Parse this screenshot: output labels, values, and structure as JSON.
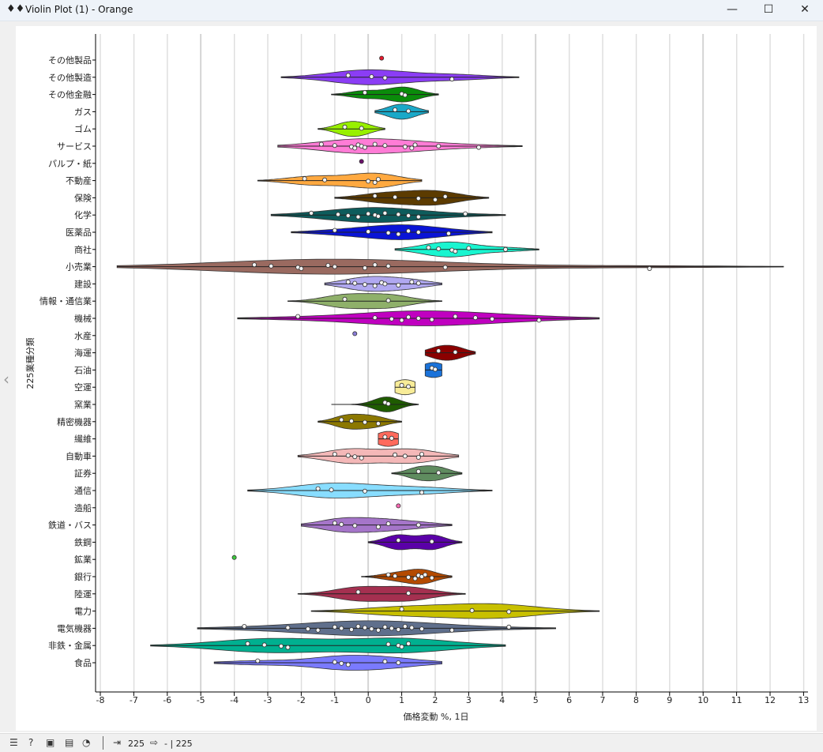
{
  "window": {
    "title": "Violin Plot (1) - Orange",
    "app_icon": "violin-plot-icon",
    "controls": {
      "minimize": "—",
      "maximize": "☐",
      "close": "✕"
    }
  },
  "statusbar": {
    "icons": [
      "menu-icon",
      "help-icon",
      "save-icon",
      "report-icon",
      "snail-icon"
    ],
    "input_label": "225",
    "output_label": "- | 225"
  },
  "colors": {
    "chart_bg": "#ffffff",
    "frame_bg": "#f0f0f0",
    "grid_minor": "#d0d0d0",
    "grid_major": "#888888"
  },
  "chart_data": {
    "type": "violin",
    "orientation": "horizontal",
    "title": "",
    "xlabel": "価格変動 %, 1日",
    "ylabel": "225業種分類",
    "xlim": [
      -8,
      13
    ],
    "x_ticks": [
      "-8",
      "-7",
      "-6",
      "-5",
      "-4",
      "-3",
      "-2",
      "-1",
      "0",
      "1",
      "2",
      "3",
      "4",
      "5",
      "6",
      "7",
      "8",
      "9",
      "10",
      "11",
      "12",
      "13"
    ],
    "grid": true,
    "categories": [
      {
        "name": "その他製品",
        "color": "#e8192c",
        "lo": 0.4,
        "hi": 0.4,
        "points": [
          0.4
        ]
      },
      {
        "name": "その他製造",
        "color": "#8b3df5",
        "lo": -2.6,
        "hi": 4.5,
        "points": [
          -0.6,
          0.1,
          0.5,
          2.5
        ]
      },
      {
        "name": "その他金融",
        "color": "#0a8c0a",
        "lo": -1.1,
        "hi": 2.1,
        "points": [
          -0.1,
          1.0,
          1.1
        ]
      },
      {
        "name": "ガス",
        "color": "#1aa8c8",
        "lo": 0.2,
        "hi": 1.8,
        "points": [
          0.8,
          1.2
        ]
      },
      {
        "name": "ゴム",
        "color": "#98f000",
        "lo": -1.5,
        "hi": 0.5,
        "points": [
          -0.7,
          -0.2
        ]
      },
      {
        "name": "サービス",
        "color": "#ff7cd6",
        "lo": -2.7,
        "hi": 4.6,
        "points": [
          -1.4,
          -1.0,
          -0.5,
          -0.4,
          -0.3,
          -0.2,
          -0.1,
          0.2,
          0.5,
          1.1,
          1.3,
          1.4,
          2.1,
          3.3
        ]
      },
      {
        "name": "パルプ・紙",
        "color": "#6c0f6c",
        "lo": -0.2,
        "hi": -0.2,
        "points": [
          -0.2
        ]
      },
      {
        "name": "不動産",
        "color": "#ffa940",
        "lo": -3.3,
        "hi": 1.6,
        "points": [
          -1.9,
          -1.3,
          0.0,
          0.2,
          0.3
        ]
      },
      {
        "name": "保険",
        "color": "#5c3b00",
        "lo": -1.0,
        "hi": 3.6,
        "points": [
          0.2,
          0.8,
          1.5,
          2.0,
          2.3
        ]
      },
      {
        "name": "化学",
        "color": "#0d5c5c",
        "lo": -2.9,
        "hi": 4.1,
        "points": [
          -1.7,
          -0.9,
          -0.6,
          -0.3,
          0.0,
          0.2,
          0.3,
          0.5,
          0.9,
          1.2,
          1.5,
          2.9
        ]
      },
      {
        "name": "医薬品",
        "color": "#0a14d6",
        "lo": -2.3,
        "hi": 3.7,
        "points": [
          -1.0,
          0.0,
          0.6,
          0.9,
          1.2,
          1.5,
          2.4
        ]
      },
      {
        "name": "商社",
        "color": "#19f5d0",
        "lo": 0.8,
        "hi": 5.1,
        "points": [
          1.8,
          2.1,
          2.5,
          2.6,
          3.0,
          4.1
        ]
      },
      {
        "name": "小売業",
        "color": "#9a6a60",
        "lo": -7.5,
        "hi": 12.4,
        "points": [
          -3.4,
          -2.9,
          -2.1,
          -2.0,
          -1.2,
          -1.0,
          -0.1,
          0.2,
          0.6,
          2.3,
          8.4
        ]
      },
      {
        "name": "建設",
        "color": "#b0a8f0",
        "lo": -1.3,
        "hi": 2.2,
        "points": [
          -0.6,
          -0.4,
          -0.1,
          0.2,
          0.4,
          0.5,
          0.9,
          1.3,
          1.5
        ]
      },
      {
        "name": "情報・通信業",
        "color": "#8fb06a",
        "lo": -2.4,
        "hi": 2.2,
        "points": [
          -0.7,
          0.6
        ]
      },
      {
        "name": "機械",
        "color": "#c000c0",
        "lo": -3.9,
        "hi": 6.9,
        "points": [
          -2.1,
          0.2,
          0.7,
          1.0,
          1.2,
          1.5,
          1.9,
          2.6,
          3.2,
          3.7,
          5.1
        ]
      },
      {
        "name": "水産",
        "color": "#8a7cd8",
        "lo": -0.4,
        "hi": -0.4,
        "points": [
          -0.4
        ]
      },
      {
        "name": "海運",
        "color": "#8b0000",
        "lo": 1.7,
        "hi": 3.2,
        "points": [
          2.1,
          2.6
        ]
      },
      {
        "name": "石油",
        "color": "#1a72d9",
        "lo": 1.7,
        "hi": 2.2,
        "points": [
          1.9,
          2.0
        ]
      },
      {
        "name": "空運",
        "color": "#f8ec98",
        "lo": 0.8,
        "hi": 1.4,
        "points": [
          1.0,
          1.2
        ]
      },
      {
        "name": "窯業",
        "color": "#1f5c00",
        "lo": -1.1,
        "hi": 1.5,
        "points": [
          0.5,
          0.6
        ]
      },
      {
        "name": "精密機器",
        "color": "#8c7800",
        "lo": -1.5,
        "hi": 1.0,
        "points": [
          -0.8,
          -0.5,
          -0.1,
          0.3
        ]
      },
      {
        "name": "繊維",
        "color": "#ff6a5c",
        "lo": 0.3,
        "hi": 0.9,
        "points": [
          0.5,
          0.7
        ]
      },
      {
        "name": "自動車",
        "color": "#f4b8b8",
        "lo": -2.1,
        "hi": 2.7,
        "points": [
          -1.0,
          -0.6,
          -0.4,
          -0.2,
          0.8,
          1.1,
          1.5,
          1.6
        ]
      },
      {
        "name": "証券",
        "color": "#5f8c5f",
        "lo": 0.7,
        "hi": 2.8,
        "points": [
          1.5,
          2.1
        ]
      },
      {
        "name": "通信",
        "color": "#88ddff",
        "lo": -3.6,
        "hi": 3.7,
        "points": [
          -1.5,
          -1.1,
          -0.1,
          1.6
        ]
      },
      {
        "name": "造船",
        "color": "#ff69b4",
        "lo": 0.9,
        "hi": 0.9,
        "points": [
          0.9
        ]
      },
      {
        "name": "鉄道・バス",
        "color": "#a575c9",
        "lo": -2.0,
        "hi": 2.5,
        "points": [
          -1.0,
          -0.8,
          -0.4,
          0.3,
          0.6,
          1.5
        ]
      },
      {
        "name": "鉄鋼",
        "color": "#5a00a8",
        "lo": 0.0,
        "hi": 2.8,
        "points": [
          0.9,
          1.9
        ]
      },
      {
        "name": "鉱業",
        "color": "#3cc83c",
        "lo": -4.0,
        "hi": -4.0,
        "points": [
          -4.0
        ]
      },
      {
        "name": "銀行",
        "color": "#b44a00",
        "lo": -0.2,
        "hi": 2.5,
        "points": [
          0.6,
          0.8,
          1.2,
          1.4,
          1.5,
          1.6,
          1.9,
          1.7
        ]
      },
      {
        "name": "陸運",
        "color": "#a53050",
        "lo": -2.1,
        "hi": 2.9,
        "points": [
          -0.3,
          1.2
        ]
      },
      {
        "name": "電力",
        "color": "#c8c000",
        "lo": -1.7,
        "hi": 6.9,
        "points": [
          1.0,
          3.1,
          4.2
        ]
      },
      {
        "name": "電気機器",
        "color": "#5f6f8c",
        "lo": -5.1,
        "hi": 5.6,
        "points": [
          -3.7,
          -2.4,
          -1.8,
          -1.5,
          -1.0,
          -0.8,
          -0.5,
          -0.3,
          -0.1,
          0.1,
          0.3,
          0.5,
          0.7,
          0.9,
          1.1,
          1.3,
          1.6,
          2.5,
          4.2
        ]
      },
      {
        "name": "非鉄・金属",
        "color": "#00b090",
        "lo": -6.5,
        "hi": 4.1,
        "points": [
          -3.6,
          -3.1,
          -2.6,
          -2.4,
          0.6,
          0.9,
          1.0,
          1.2
        ]
      },
      {
        "name": "食品",
        "color": "#7a7aff",
        "lo": -4.6,
        "hi": 2.2,
        "points": [
          -3.3,
          -1.0,
          -0.8,
          -0.6,
          0.5,
          0.9
        ]
      }
    ]
  }
}
